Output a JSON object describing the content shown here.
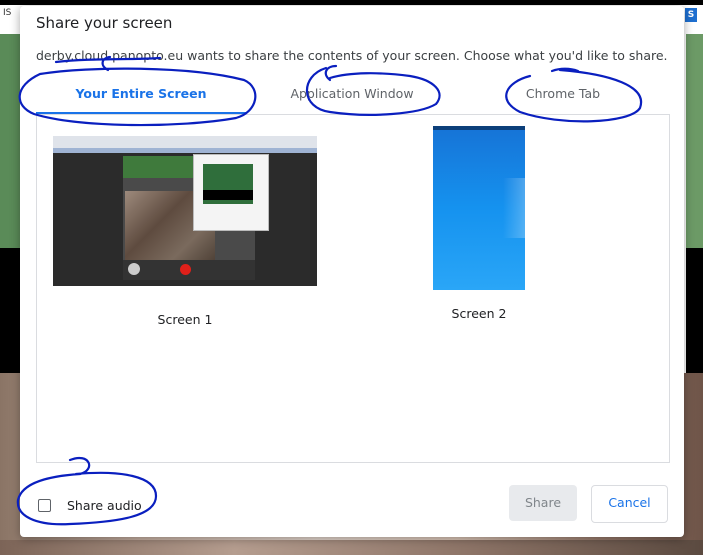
{
  "background": {
    "left_text": "IS",
    "right_icon_letter": "S"
  },
  "dialog": {
    "title": "Share your screen",
    "description": "derby.cloud.panopto.eu wants to share the contents of your screen. Choose what you'd like to share.",
    "tabs": [
      {
        "label": "Your Entire Screen",
        "active": true
      },
      {
        "label": "Application Window",
        "active": false
      },
      {
        "label": "Chrome Tab",
        "active": false
      }
    ],
    "screens": [
      {
        "label": "Screen 1",
        "thumbnail": "desktop-with-video-call"
      },
      {
        "label": "Screen 2",
        "thumbnail": "windows-blue-desktop"
      }
    ],
    "share_audio": {
      "label": "Share audio",
      "checked": false
    },
    "buttons": {
      "share": "Share",
      "share_enabled": false,
      "cancel": "Cancel"
    }
  },
  "colors": {
    "accent": "#1a73e8",
    "annotation_ink": "#0a1fbf"
  }
}
